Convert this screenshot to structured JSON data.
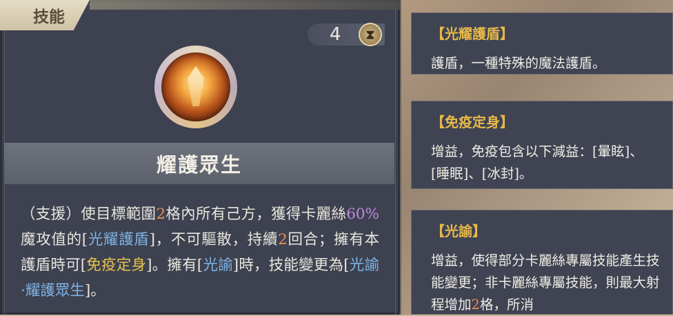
{
  "tab": {
    "label": "技能"
  },
  "skill": {
    "cost_value": "4",
    "cost_icon": "hourglass-icon",
    "name": "耀護眾生",
    "description_parts": {
      "p1": "（支援）使目標範圍",
      "range": "2",
      "p2": "格內所有己方，獲得卡麗絲",
      "percent": "60%",
      "p3": "魔攻值的[",
      "link1": "光耀護盾",
      "p4": "]，不可驅散，持續",
      "turns": "2",
      "p5": "回合；擁有本護盾時可[",
      "link2": "免疫定身",
      "p6": "]。擁有[",
      "link3": "光諭",
      "p7": "]時，技能變更為[",
      "link4": "光諭·耀護眾生",
      "p8": "]。"
    }
  },
  "cards": [
    {
      "title": "【光耀護盾】",
      "body": "護盾，一種特殊的魔法護盾。"
    },
    {
      "title": "【免疫定身】",
      "body": "增益，免疫包含以下減益：[暈眩]、[睡眠]、[冰封]。"
    },
    {
      "title": "【光諭】",
      "body_a": "增益，使得部分卡麗絲專屬技能產生技能變更；非卡麗絲專屬技能，則最大射程增加",
      "body_num": "2",
      "body_b": "格，所消"
    }
  ],
  "colors": {
    "panel_bg": "#3d4150",
    "title_gold": "#e8b949",
    "highlight_orange": "#ec8e55",
    "highlight_purple": "#c18ae0",
    "highlight_blue": "#7fb4e6",
    "highlight_yellow": "#e8c44d"
  }
}
